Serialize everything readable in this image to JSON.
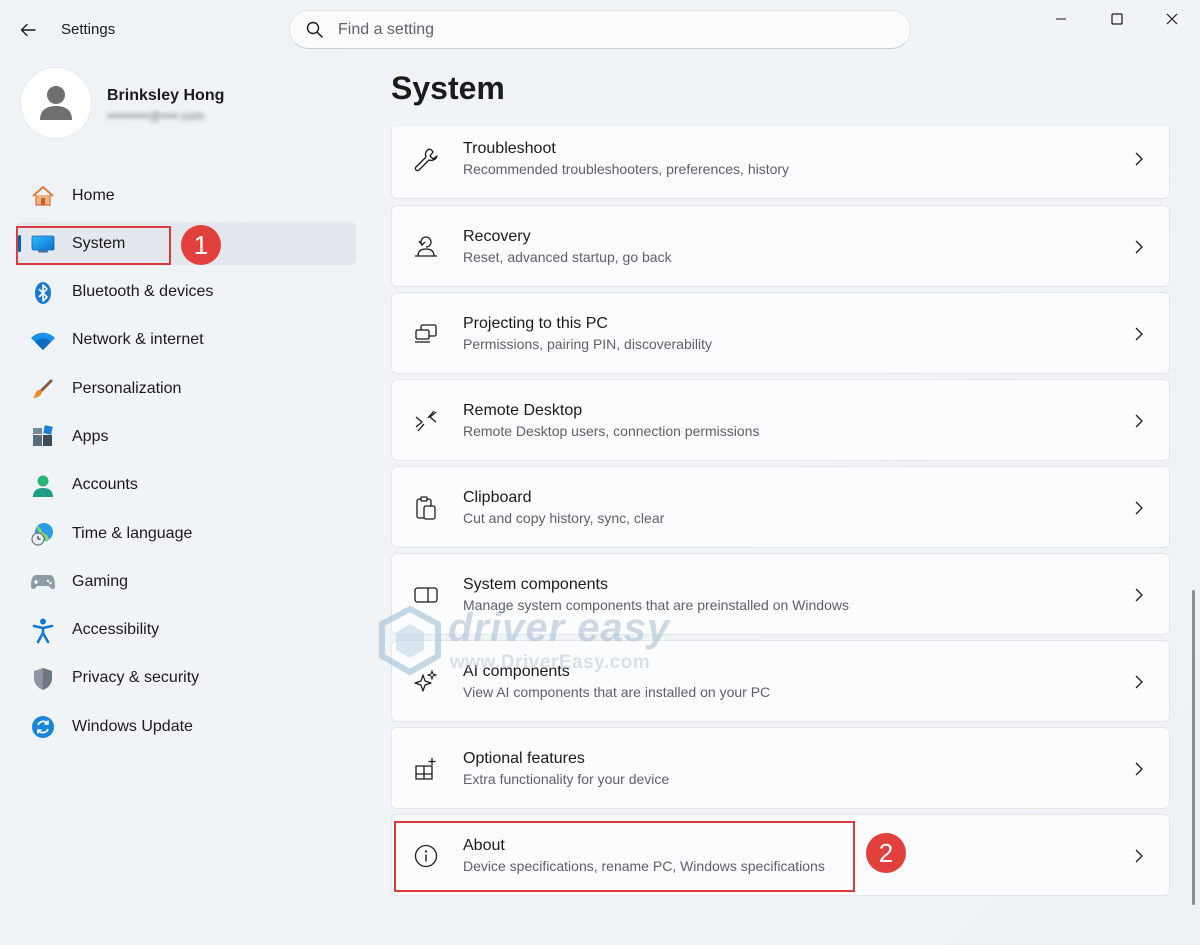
{
  "window": {
    "title": "Settings"
  },
  "search": {
    "placeholder": "Find a setting"
  },
  "profile": {
    "name": "Brinksley Hong",
    "email": "••••••••••@••••.com"
  },
  "nav": {
    "items": [
      {
        "label": "Home",
        "icon": "home-icon",
        "active": false
      },
      {
        "label": "System",
        "icon": "system-icon",
        "active": true
      },
      {
        "label": "Bluetooth & devices",
        "icon": "bluetooth-icon",
        "active": false
      },
      {
        "label": "Network & internet",
        "icon": "wifi-icon",
        "active": false
      },
      {
        "label": "Personalization",
        "icon": "brush-icon",
        "active": false
      },
      {
        "label": "Apps",
        "icon": "apps-icon",
        "active": false
      },
      {
        "label": "Accounts",
        "icon": "accounts-icon",
        "active": false
      },
      {
        "label": "Time & language",
        "icon": "globe-clock-icon",
        "active": false
      },
      {
        "label": "Gaming",
        "icon": "gamepad-icon",
        "active": false
      },
      {
        "label": "Accessibility",
        "icon": "accessibility-icon",
        "active": false
      },
      {
        "label": "Privacy & security",
        "icon": "shield-icon",
        "active": false
      },
      {
        "label": "Windows Update",
        "icon": "update-icon",
        "active": false
      }
    ]
  },
  "main": {
    "title": "System",
    "items": [
      {
        "title": "Troubleshoot",
        "description": "Recommended troubleshooters, preferences, history",
        "icon": "wrench-icon"
      },
      {
        "title": "Recovery",
        "description": "Reset, advanced startup, go back",
        "icon": "recovery-icon"
      },
      {
        "title": "Projecting to this PC",
        "description": "Permissions, pairing PIN, discoverability",
        "icon": "projecting-icon"
      },
      {
        "title": "Remote Desktop",
        "description": "Remote Desktop users, connection permissions",
        "icon": "remote-desktop-icon"
      },
      {
        "title": "Clipboard",
        "description": "Cut and copy history, sync, clear",
        "icon": "clipboard-icon"
      },
      {
        "title": "System components",
        "description": "Manage system components that are preinstalled on Windows",
        "icon": "system-components-icon"
      },
      {
        "title": "AI components",
        "description": "View AI components that are installed on your PC",
        "icon": "sparkle-icon"
      },
      {
        "title": "Optional features",
        "description": "Extra functionality for your device",
        "icon": "optional-features-icon"
      },
      {
        "title": "About",
        "description": "Device specifications, rename PC, Windows specifications",
        "icon": "info-icon"
      }
    ]
  },
  "annotations": {
    "step1": "1",
    "step2": "2",
    "color": "#dc3b3b"
  },
  "watermark": {
    "brand": "driver easy",
    "url": "www.DriverEasy.com"
  },
  "colors": {
    "accent": "#0067c0",
    "background": "#eef3f8",
    "card": "#fbfcfd"
  }
}
